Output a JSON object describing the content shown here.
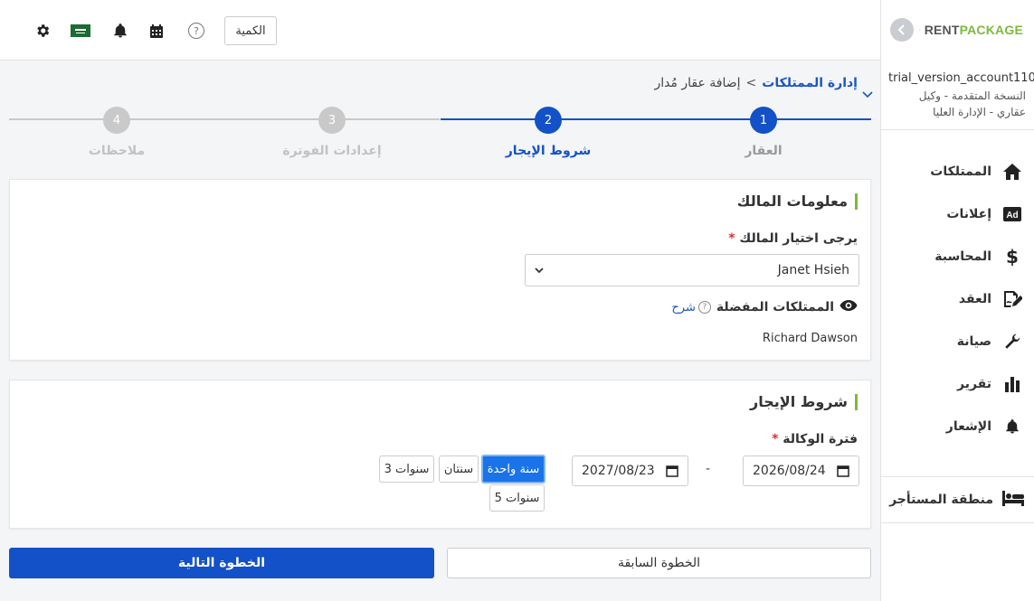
{
  "header": {
    "quantity_button": "الكمية",
    "help_symbol": "?",
    "icons": [
      "gear-icon",
      "saudi-flag-icon",
      "bell-icon",
      "calendar-icon",
      "help-icon"
    ]
  },
  "logo": {
    "rent": "RENT",
    "package": "PACKAGE"
  },
  "account": {
    "name": "trial_version_account110",
    "role": "النسخة المتقدمة - وكيل عقاري - الإدارة العليا"
  },
  "sidebar": {
    "items": [
      {
        "label": "الممتلكات",
        "icon": "home-icon"
      },
      {
        "label": "إعلانات",
        "icon": "ad-icon"
      },
      {
        "label": "المحاسبة",
        "icon": "dollar-icon"
      },
      {
        "label": "العقد",
        "icon": "contract-icon"
      },
      {
        "label": "صيانة",
        "icon": "wrench-icon"
      },
      {
        "label": "تقرير",
        "icon": "chart-icon"
      },
      {
        "label": "الإشعار",
        "icon": "bell-icon"
      }
    ],
    "tenant_area": "منطقة المستأجر"
  },
  "breadcrumb": {
    "parent": "إدارة الممتلكات",
    "separator": ">",
    "current": "إضافة عقار مُدار"
  },
  "stepper": {
    "steps": [
      {
        "number": "1",
        "label": "العقار",
        "state": "done"
      },
      {
        "number": "2",
        "label": "شروط الإيجار",
        "state": "active"
      },
      {
        "number": "3",
        "label": "إعدادات الفوترة",
        "state": "pending"
      },
      {
        "number": "4",
        "label": "ملاحظات",
        "state": "pending"
      }
    ]
  },
  "owner_card": {
    "title": "معلومات المالك",
    "owner_label": "يرجى اختيار المالك",
    "required_mark": "*",
    "owner_selected": "Janet Hsieh",
    "favorites_title": "الممتلكات المفضلة",
    "explain_link": "شرح",
    "favorites_value": "Richard Dawson"
  },
  "lease_card": {
    "title": "شروط الإيجار",
    "period_label": "فترة الوكالة",
    "required_mark": "*",
    "start_date": "2026/08/24",
    "end_date": "2027/08/23",
    "dash": "-",
    "period_options": [
      "سنة واحدة",
      "سنتان",
      "3 سنوات",
      "5 سنوات"
    ],
    "active_option": "سنة واحدة"
  },
  "footer": {
    "next_button": "الخطوة التالية",
    "prev_button": "الخطوة السابقة"
  },
  "colors": {
    "primary": "#1351c9",
    "accent_green": "#7dba3c",
    "pending_step": "#c9c9c9",
    "required": "#d9342b"
  }
}
